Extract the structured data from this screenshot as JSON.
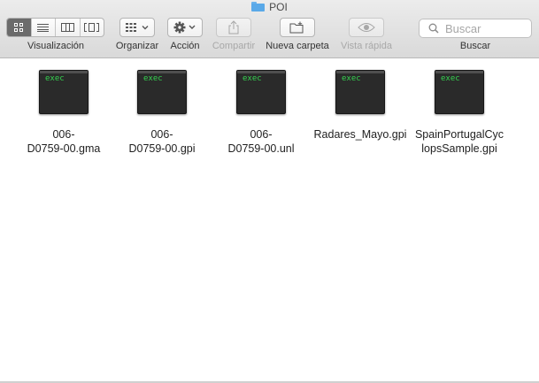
{
  "window": {
    "title": "POI"
  },
  "toolbar": {
    "visualizacion_label": "Visualización",
    "organizar_label": "Organizar",
    "accion_label": "Acción",
    "compartir_label": "Compartir",
    "nueva_carpeta_label": "Nueva carpeta",
    "vista_rapida_label": "Vista rápida",
    "buscar_label": "Buscar"
  },
  "search": {
    "placeholder": "Buscar"
  },
  "files": [
    {
      "icon_text": "exec",
      "name_line1": "006-",
      "name_line2": "D0759-00.gma"
    },
    {
      "icon_text": "exec",
      "name_line1": "006-",
      "name_line2": "D0759-00.gpi"
    },
    {
      "icon_text": "exec",
      "name_line1": "006-",
      "name_line2": "D0759-00.unl"
    },
    {
      "icon_text": "exec",
      "name_line1": "Radares_Mayo.gpi",
      "name_line2": ""
    },
    {
      "icon_text": "exec",
      "name_line1": "SpainPortugalCyc",
      "name_line2": "lopsSample.gpi"
    }
  ],
  "icons": {
    "view_icons": "icon-view-icon",
    "view_list": "list-view-icon",
    "view_columns": "column-view-icon",
    "view_coverflow": "coverflow-view-icon",
    "arrange": "arrange-icon",
    "action": "gear-icon",
    "share": "share-icon",
    "new_folder": "new-folder-icon",
    "quick_look": "eye-icon",
    "search": "search-icon"
  },
  "colors": {
    "exec_text": "#35d04f",
    "folder": "#5aa9e8",
    "active_segment": "#6b6b6b"
  }
}
